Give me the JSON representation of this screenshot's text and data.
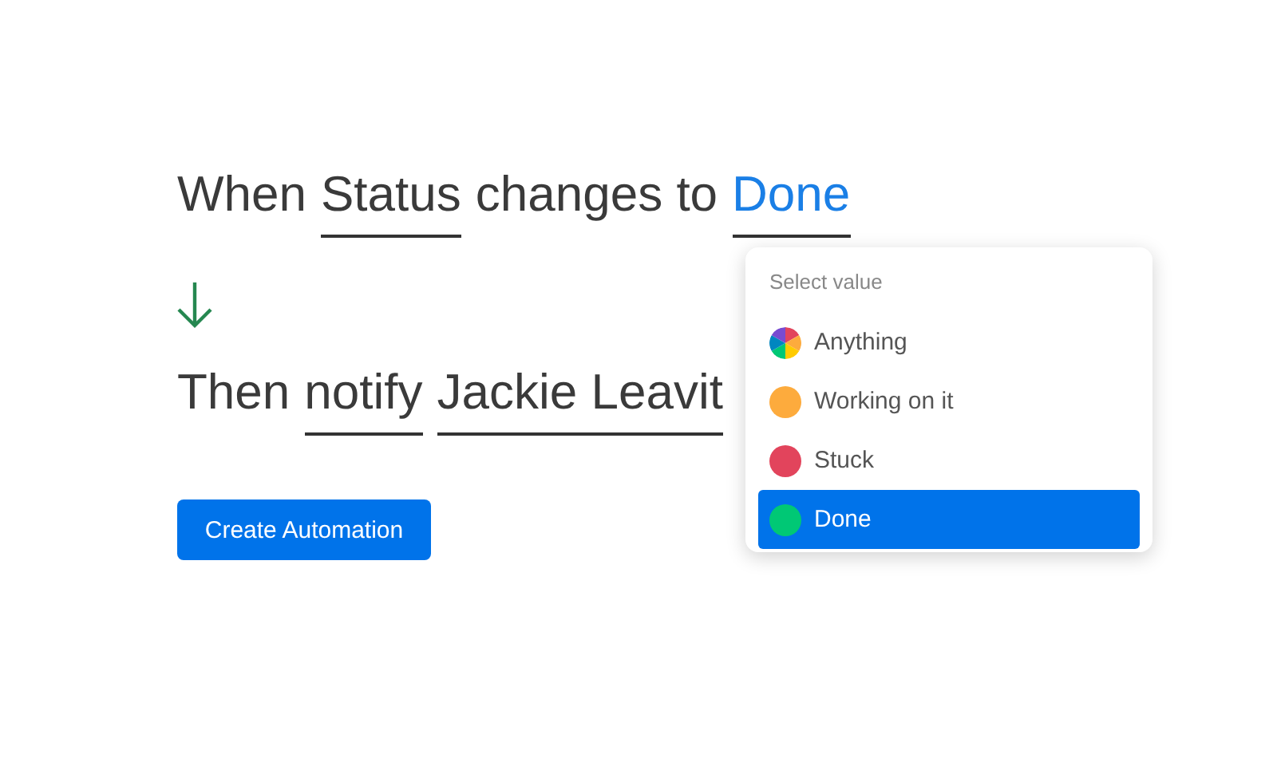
{
  "rules": [
    {
      "segments": [
        {
          "kind": "text",
          "text": "When"
        },
        {
          "kind": "field",
          "text": "Status",
          "active": false
        },
        {
          "kind": "text",
          "text": "changes to"
        },
        {
          "kind": "field",
          "text": "Done",
          "active": true
        }
      ]
    },
    {
      "segments": [
        {
          "kind": "text",
          "text": "Then"
        },
        {
          "kind": "field",
          "text": "notify",
          "active": false
        },
        {
          "kind": "field",
          "text": "Jackie Leavit",
          "active": false
        }
      ]
    }
  ],
  "button": {
    "label": "Create Automation"
  },
  "dropdown": {
    "title": "Select value",
    "options": [
      {
        "label": "Anything",
        "kind": "multi",
        "selected": false
      },
      {
        "label": "Working on it",
        "kind": "dot",
        "color": "#fdab3d",
        "selected": false
      },
      {
        "label": "Stuck",
        "kind": "dot",
        "color": "#e2445c",
        "selected": false
      },
      {
        "label": "Done",
        "kind": "dot",
        "color": "#00c875",
        "selected": true
      }
    ]
  }
}
